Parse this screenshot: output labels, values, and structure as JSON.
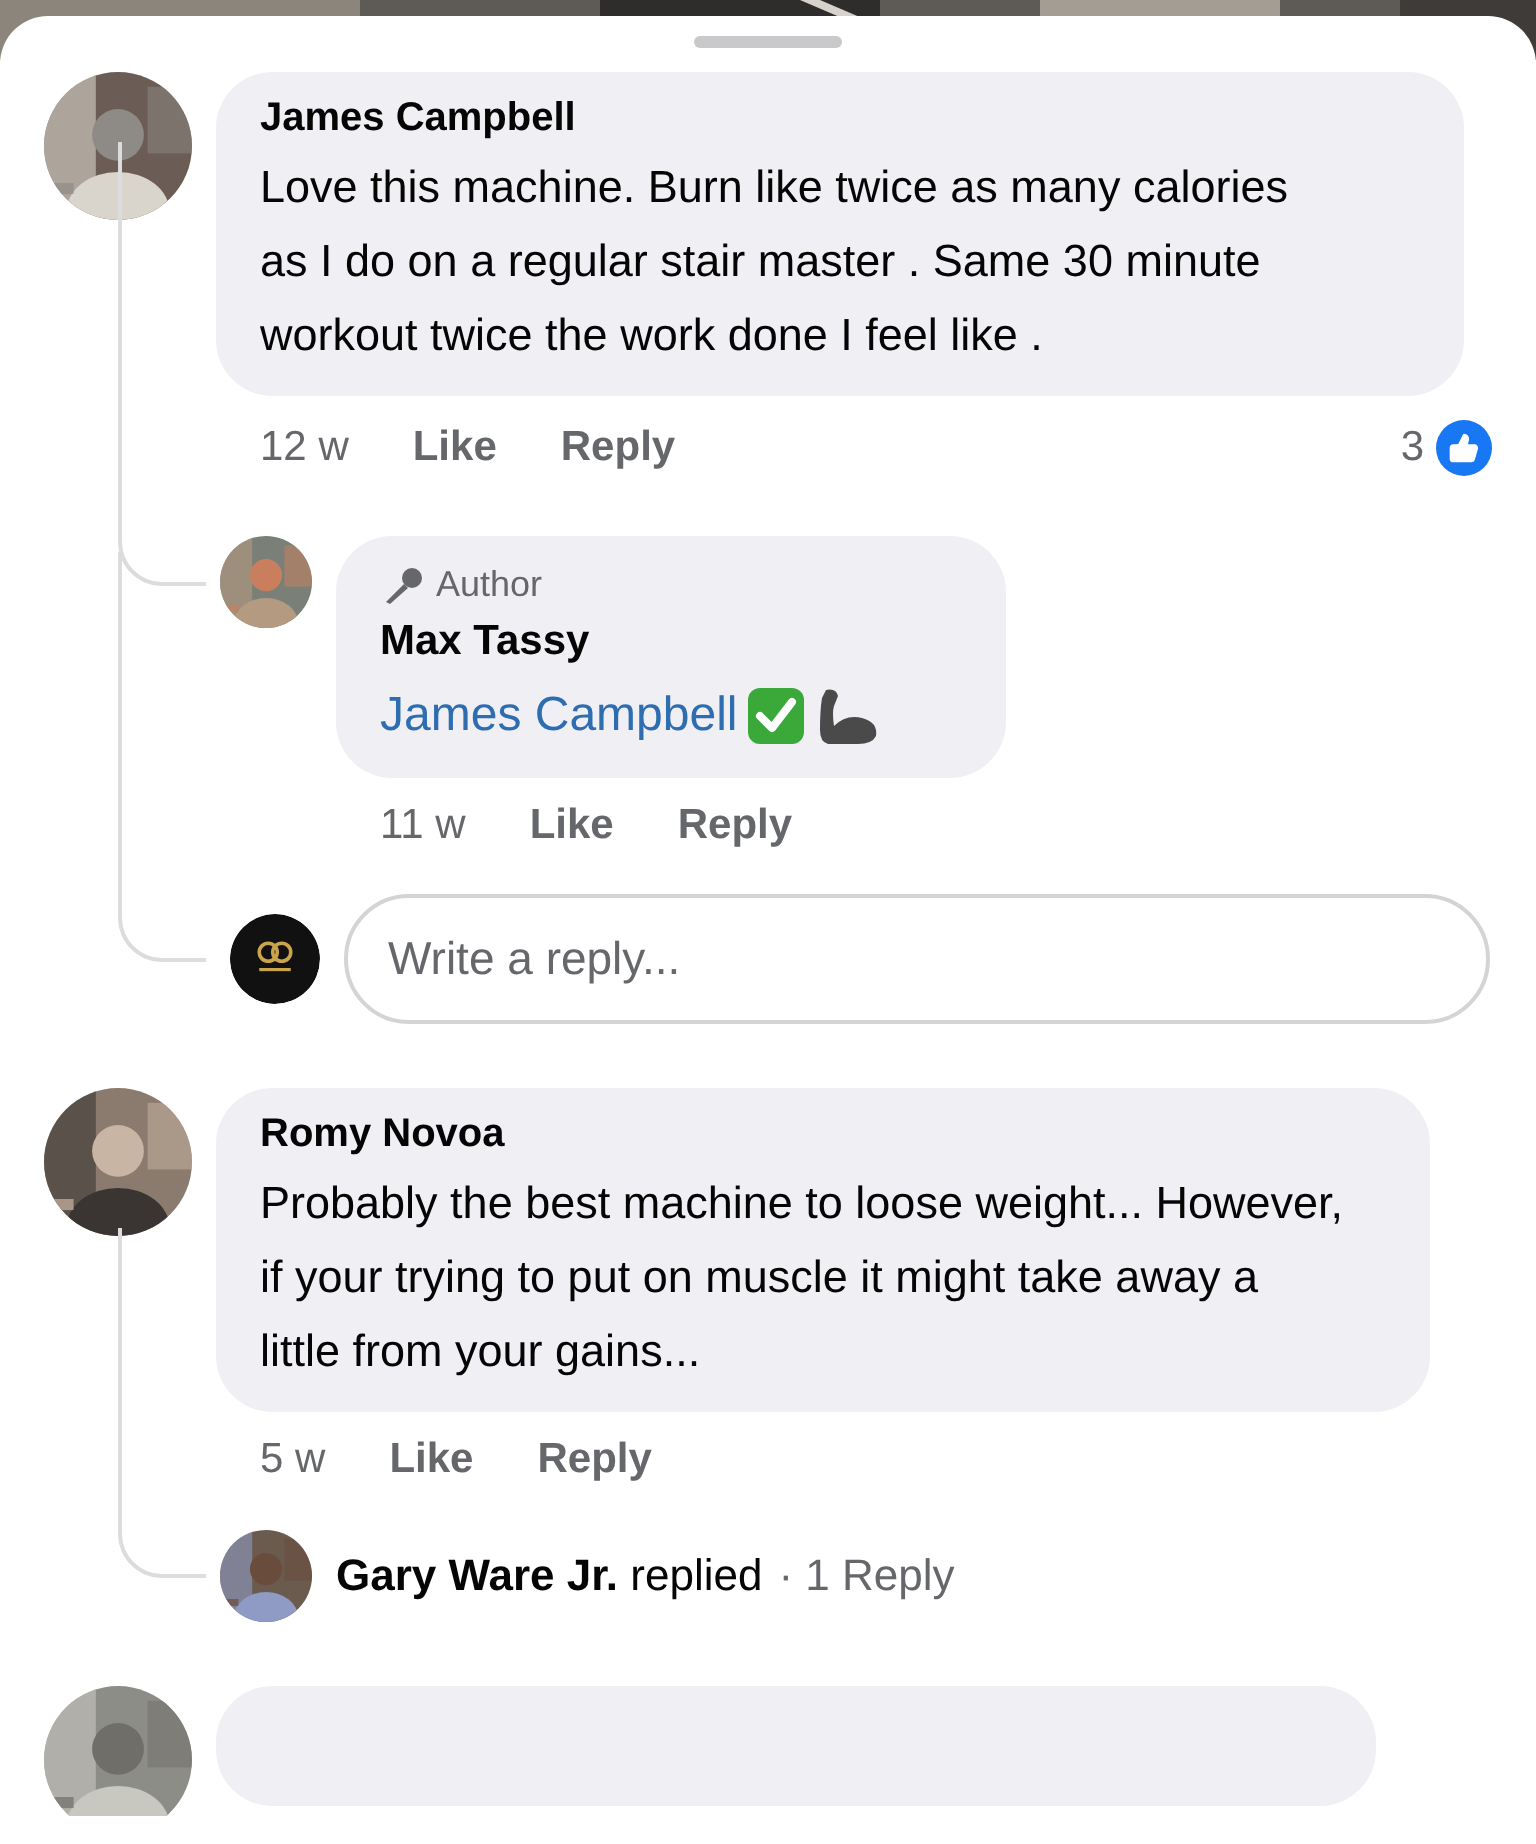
{
  "comments": [
    {
      "kind": "comment",
      "author": "James Campbell",
      "text": "Love this machine. Burn like twice as many calories as I do on a regular stair master . Same 30 minute workout twice the work done I feel like .",
      "time": "12 w",
      "actions": [
        "Like",
        "Reply"
      ],
      "reaction_count": "3",
      "replies": [
        {
          "badge": "Author",
          "author": "Max Tassy",
          "mention": "James Campbell",
          "time": "11 w",
          "actions": [
            "Like",
            "Reply"
          ]
        }
      ],
      "reply_field": {
        "placeholder": "Write a reply..."
      }
    },
    {
      "kind": "comment",
      "author": "Romy Novoa",
      "text": "Probably the best machine to loose weight... However, if your trying to put on muscle it might take away a little from your gains...",
      "time": "5 w",
      "actions": [
        "Like",
        "Reply"
      ],
      "replies_summary": {
        "who": "**Gary Ware Jr.** replied",
        "count": "· 1 Reply"
      }
    },
    {
      "kind": "cut_off"
    }
  ]
}
